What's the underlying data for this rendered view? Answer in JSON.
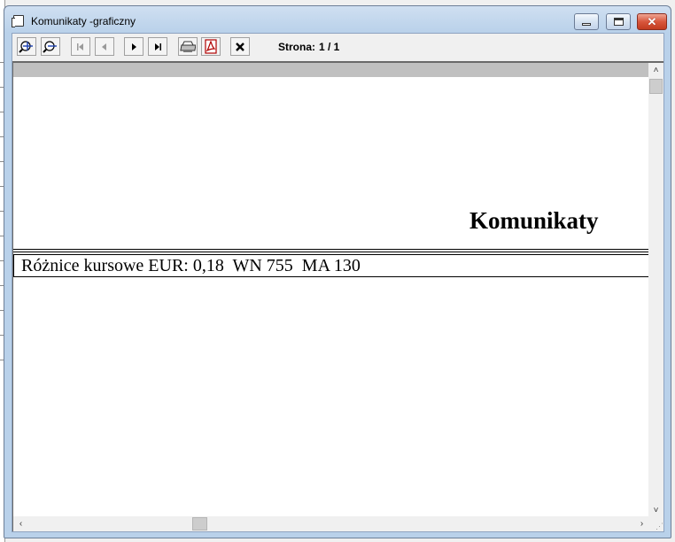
{
  "window": {
    "title": "Komunikaty -graficzny",
    "close_glyph": "✕"
  },
  "toolbar": {
    "buttons": [
      {
        "name": "zoom-in-icon"
      },
      {
        "name": "zoom-out-icon"
      },
      {
        "name": "first-page-icon",
        "enabled": false
      },
      {
        "name": "previous-page-icon",
        "enabled": false
      },
      {
        "name": "next-page-icon"
      },
      {
        "name": "last-page-icon"
      },
      {
        "name": "print-icon"
      },
      {
        "name": "pdf-export-icon"
      },
      {
        "name": "close-icon"
      }
    ],
    "page_label": "Strona:",
    "page_value": "1 / 1"
  },
  "report": {
    "title": "Komunikaty",
    "message": "Różnice kursowe EUR: 0,18  WN 755  MA 130"
  },
  "colors": {
    "titlebar": "#b9d1ea",
    "close_button": "#c23b1f",
    "gray_strip": "#c0c0c0",
    "pdf_red": "#b00000"
  }
}
